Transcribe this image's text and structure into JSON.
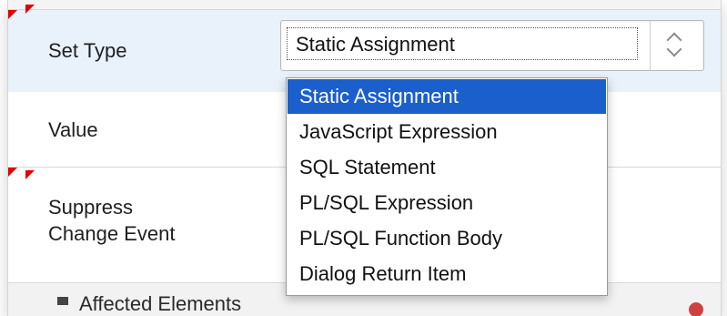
{
  "form": {
    "set_type": {
      "label": "Set Type",
      "selected_value": "Static Assignment"
    },
    "value": {
      "label": "Value"
    },
    "suppress_change_event": {
      "label_line1": "Suppress",
      "label_line2": "Change Event"
    },
    "affected_elements": {
      "label": "Affected Elements"
    }
  },
  "dropdown": {
    "options": [
      {
        "label": "Static Assignment",
        "selected": true
      },
      {
        "label": "JavaScript Expression",
        "selected": false
      },
      {
        "label": "SQL Statement",
        "selected": false
      },
      {
        "label": "PL/SQL Expression",
        "selected": false
      },
      {
        "label": "PL/SQL Function Body",
        "selected": false
      },
      {
        "label": "Dialog Return Item",
        "selected": false
      }
    ]
  },
  "colors": {
    "selected_option_bg": "#1a5fcb",
    "required_marker": "#e00000",
    "active_row_bg": "#e9f1fb"
  }
}
